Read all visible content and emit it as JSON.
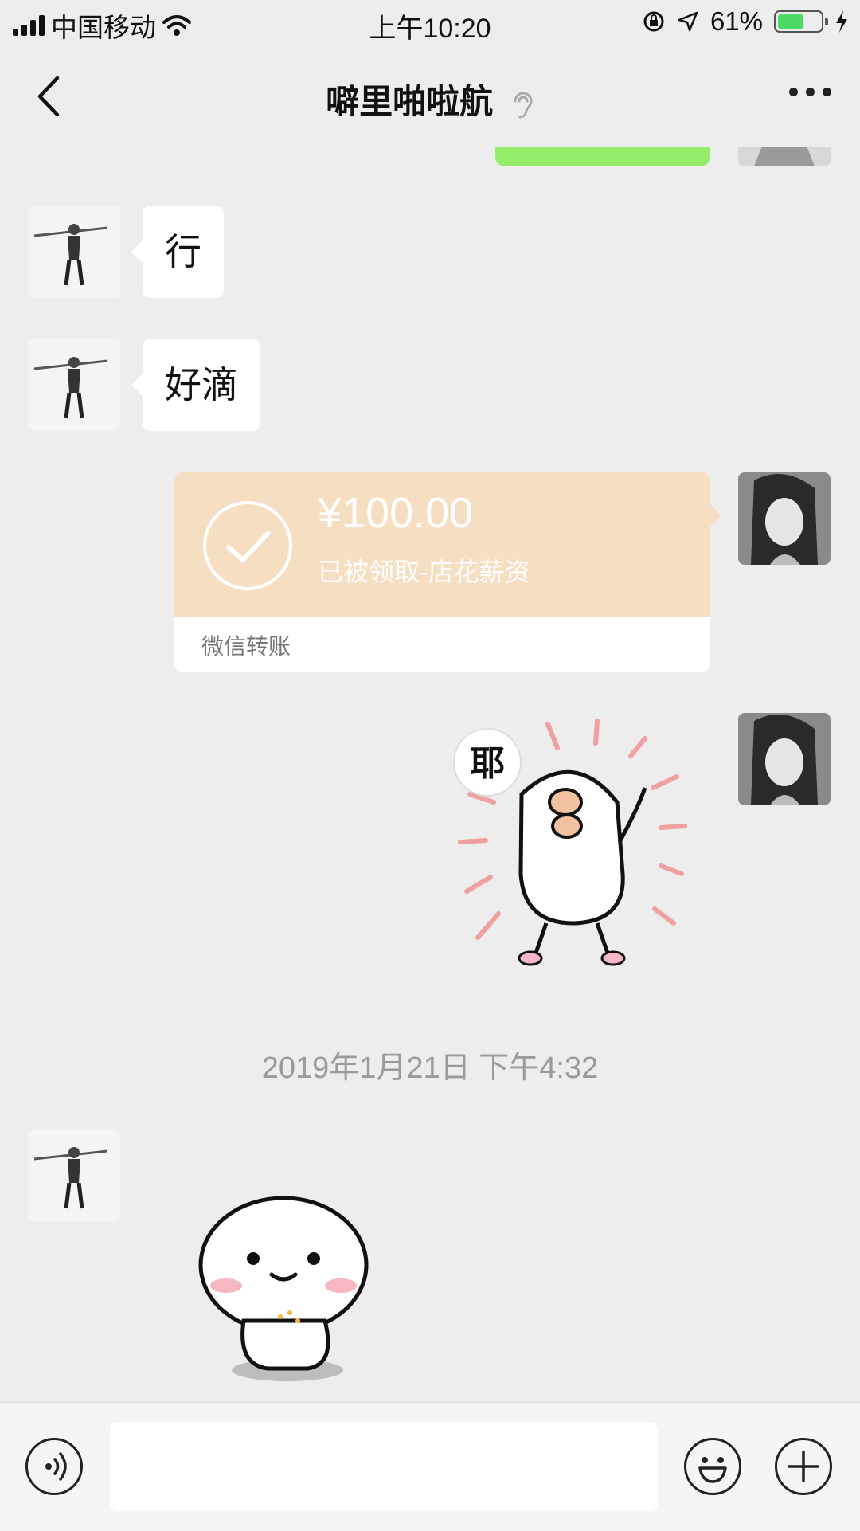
{
  "status_bar": {
    "carrier": "中国移动",
    "time": "上午10:20",
    "battery_percent": "61%",
    "battery_level": 0.61,
    "icons": [
      "signal-icon",
      "wifi-icon",
      "rotation-lock-icon",
      "location-icon",
      "battery-icon",
      "charging-icon"
    ]
  },
  "nav": {
    "title": "噼里啪啦航",
    "icons": [
      "back-icon",
      "ear-icon",
      "more-icon"
    ]
  },
  "messages": {
    "m1": "行",
    "m2": "好滴",
    "transfer": {
      "amount": "¥100.00",
      "note": "已被领取-店花薪资",
      "footer": "微信转账"
    },
    "sticker1_text": "耶",
    "timestamp": "2019年1月21日 下午4:32"
  },
  "input_bar": {
    "placeholder": "",
    "icons": [
      "voice-icon",
      "emoji-icon",
      "plus-icon"
    ]
  },
  "colors": {
    "background": "#ededed",
    "green_bubble": "#95ec69",
    "transfer_card": "#f6dec2"
  }
}
